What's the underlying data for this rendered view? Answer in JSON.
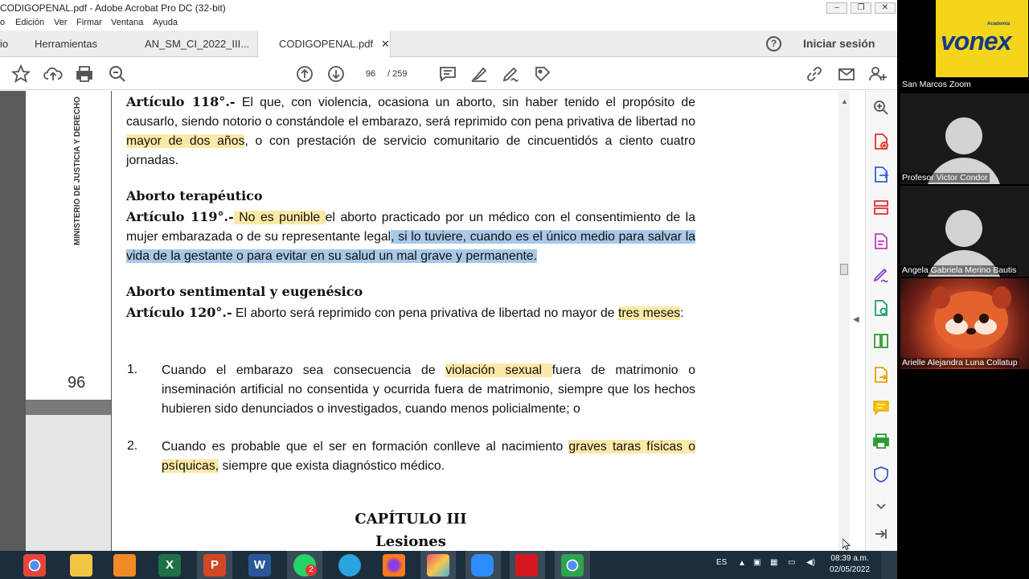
{
  "window": {
    "title": "CODIGOPENAL.pdf - Adobe Acrobat Pro DC (32-bit)",
    "min": "–",
    "max": "❐",
    "close": "✕"
  },
  "menu": [
    "o",
    "Edición",
    "Ver",
    "Firmar",
    "Ventana",
    "Ayuda"
  ],
  "tabs": {
    "home": "io",
    "tools": "Herramientas",
    "doc1": "AN_SM_CI_2022_III...",
    "doc2": "CODIGOPENAL.pdf",
    "doc2_close": "✕"
  },
  "help": "?",
  "signin": "Iniciar sesión",
  "toolbar": {
    "current_page": "96",
    "total_pages": "/  259"
  },
  "sidebar": {
    "vertical_text": "MINISTERIO DE JUSTICIA Y DERECHO",
    "page_number": "96"
  },
  "document": {
    "art118_title": "Artículo 118°.-",
    "art118_p1": " El que, con violencia, ocasiona un aborto, sin haber tenido el propósito de causarlo, siendo notorio o constándole el embarazo, será reprimido con pena privativa de libertad no ",
    "art118_hl": "mayor de dos años",
    "art118_p2": ", o con prestación de servicio comunitario de cincuentidós a ciento cuatro jornadas.",
    "h_terapeutico": "Aborto terapéutico",
    "art119_title": "Artículo 119°.-",
    "art119_hl1": " No es punible ",
    "art119_p1": "el aborto practicado por un médico con el consentimiento de la mujer embarazada o de su representante legal",
    "art119_hl2": ", si lo tuviere, cuando es el único medio para salvar la vida de la gestante o para evitar en su salud un mal grave y permanente.",
    "h_sentimental": "Aborto sentimental y eugenésico",
    "art120_title": "Artículo 120°.-",
    "art120_p1": " El aborto será reprimido con pena privativa de libertad no mayor de ",
    "art120_hl": "tres meses",
    "art120_p2": ":",
    "item1_num": "1.",
    "item1_p1": "Cuando el embarazo sea consecuencia de ",
    "item1_hl": "violación sexual ",
    "item1_p2": "fuera de matrimonio o inseminación artificial no consentida y ocurrida fuera de matrimonio, siempre que los hechos hubieren sido denunciados o investigados, cuando menos policialmente; o",
    "item2_num": "2.",
    "item2_p1": "Cuando es probable que el ser en formación conlleve al nacimiento ",
    "item2_hl": "graves taras físicas o psíquicas,",
    "item2_p2": " siempre que exista diagnóstico médico.",
    "chapter": "CAPÍTULO III",
    "chapter_sub": "Lesiones"
  },
  "taskbar": {
    "lang": "ES",
    "time": "08:39 a.m.",
    "date": "02/05/2022",
    "whatsapp_badge": "2"
  },
  "zoom": {
    "tiles": [
      {
        "name": "San Marcos Zoom",
        "logo_small": "Academia",
        "logo_big": "vonex"
      },
      {
        "name": "Profesor Victor Condor"
      },
      {
        "name": "Angela Gabriela Merino Bautis"
      },
      {
        "name": "Arielle Alejandra Luna Collatup"
      }
    ]
  },
  "colors": {
    "highlight_yellow": "#fde9a7",
    "highlight_blue": "#a9c8e8",
    "taskbar": "#1c2d3c",
    "vonex_yellow": "#f5d51b",
    "vonex_blue": "#123a86"
  }
}
